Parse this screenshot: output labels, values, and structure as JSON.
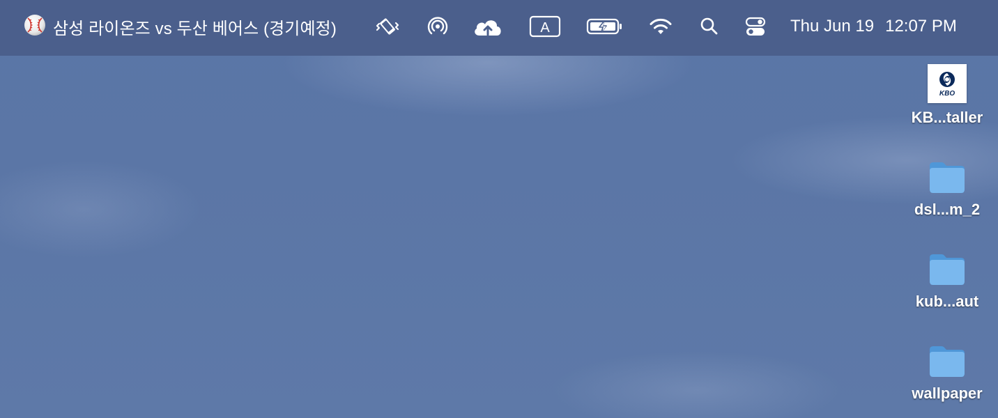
{
  "menubar": {
    "app_status_title": "삼성 라이온즈 vs 두산 베어스 (경기예정)",
    "keyboard_input_letter": "A",
    "clock": {
      "date": "Thu Jun 19",
      "time": "12:07 PM"
    },
    "icons": [
      "baseball-icon",
      "vibrate-phone-icon",
      "airdrop-icon",
      "cloud-upload-icon",
      "input-source-icon",
      "battery-charging-icon",
      "wifi-icon",
      "spotlight-search-icon",
      "control-center-icon"
    ]
  },
  "desktop": {
    "items": [
      {
        "label": "KB...taller",
        "icon": "kbo-installer-icon",
        "logo_text": "KBO"
      },
      {
        "label": "dsl...m_2",
        "icon": "folder-icon"
      },
      {
        "label": "kub...aut",
        "icon": "folder-icon"
      },
      {
        "label": "wallpaper",
        "icon": "folder-icon"
      }
    ]
  },
  "colors": {
    "menubar": "#4b5f8c",
    "desktop": "#5b76a6",
    "folder": "#7ab8ee"
  }
}
